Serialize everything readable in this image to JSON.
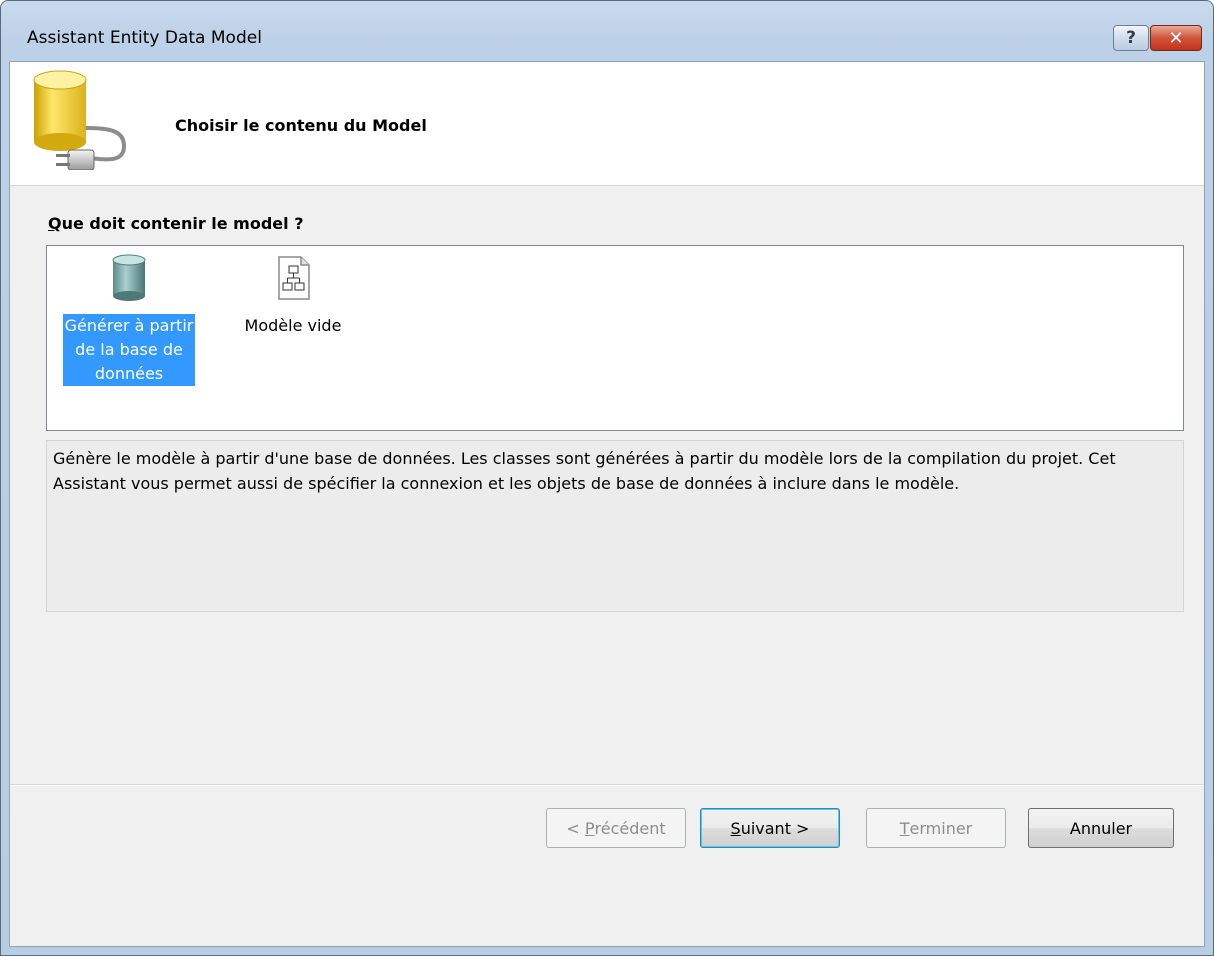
{
  "window": {
    "title": "Assistant Entity Data Model",
    "help_glyph": "?",
    "close_glyph": "✕"
  },
  "header": {
    "title": "Choisir le contenu du Model",
    "icon": "database-plug-icon"
  },
  "section": {
    "label_accel": "Q",
    "label_rest": "ue doit contenir le model ?"
  },
  "options": {
    "items": [
      {
        "label_line1": "Générer à partir",
        "label_line2": "de la base de",
        "label_line3": "données",
        "icon": "database-icon",
        "selected": true
      },
      {
        "label_line1": "Modèle vide",
        "icon": "empty-model-icon",
        "selected": false
      }
    ]
  },
  "description": "Génère le modèle à partir d'une base de données. Les classes sont générées à partir du modèle lors de la compilation du projet. Cet Assistant vous permet aussi de spécifier la connexion et les objets de base de données à inclure dans le modèle.",
  "buttons": {
    "prev_prefix": "< ",
    "prev_accel": "P",
    "prev_rest": "récédent",
    "next_accel": "S",
    "next_rest": "uivant >",
    "finish_accel": "T",
    "finish_rest": "erminer",
    "cancel": "Annuler"
  },
  "colors": {
    "selection": "#3399ff",
    "client_bg": "#f0f0f0",
    "close_red": "#c1341b"
  }
}
